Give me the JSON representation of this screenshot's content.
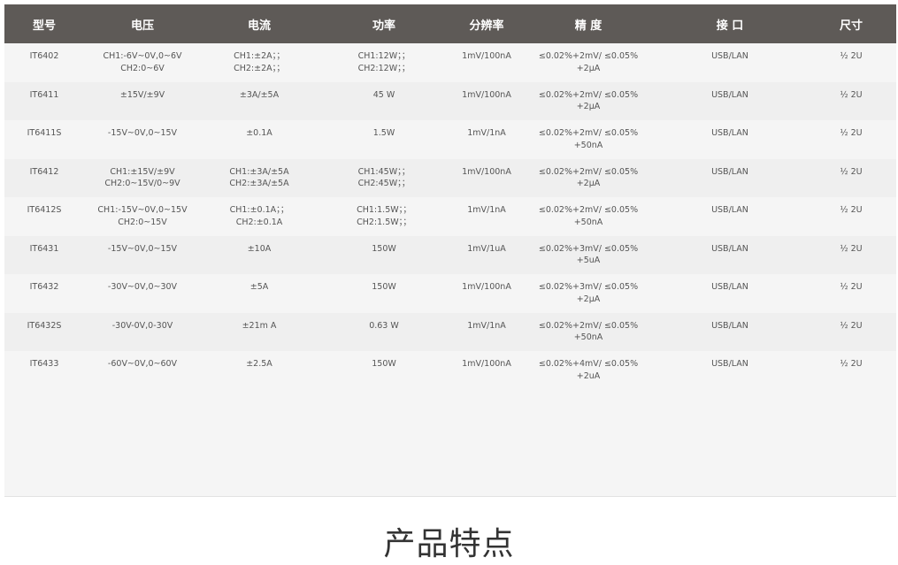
{
  "table": {
    "headers": [
      "型号",
      "电压",
      "电流",
      "功率",
      "分辨率",
      "精 度",
      "接 口",
      "尺寸"
    ],
    "rows": [
      {
        "model": "IT6402",
        "voltage": [
          "CH1:-6V~0V,0~6V",
          "CH2:0~6V"
        ],
        "current": [
          "CH1:±2A；；",
          "CH2:±2A；；"
        ],
        "power": [
          "CH1:12W；；",
          "CH2:12W；；"
        ],
        "resolution": [
          "1mV/100nA"
        ],
        "accuracy": [
          "≤0.02%+2mV/ ≤0.05%",
          "+2μA"
        ],
        "interface": "USB/LAN",
        "size": "½ 2U"
      },
      {
        "model": "IT6411",
        "voltage": [
          "±15V/±9V"
        ],
        "current": [
          "±3A/±5A"
        ],
        "power": [
          "45 W"
        ],
        "resolution": [
          "1mV/100nA"
        ],
        "accuracy": [
          "≤0.02%+2mV/ ≤0.05%",
          "+2μA"
        ],
        "interface": "USB/LAN",
        "size": "½ 2U"
      },
      {
        "model": "IT6411S",
        "voltage": [
          "-15V~0V,0~15V"
        ],
        "current": [
          "±0.1A"
        ],
        "power": [
          "1.5W"
        ],
        "resolution": [
          "1mV/1nA"
        ],
        "accuracy": [
          "≤0.02%+2mV/ ≤0.05%",
          "+50nA"
        ],
        "interface": "USB/LAN",
        "size": "½ 2U"
      },
      {
        "model": "IT6412",
        "voltage": [
          "CH1:±15V/±9V",
          "CH2:0~15V/0~9V"
        ],
        "current": [
          "CH1:±3A/±5A",
          "CH2:±3A/±5A"
        ],
        "power": [
          "CH1:45W；；",
          "CH2:45W；；"
        ],
        "resolution": [
          "1mV/100nA"
        ],
        "accuracy": [
          "≤0.02%+2mV/ ≤0.05%",
          "+2μA"
        ],
        "interface": "USB/LAN",
        "size": "½ 2U"
      },
      {
        "model": "IT6412S",
        "voltage": [
          "CH1:-15V~0V,0~15V",
          "CH2:0~15V"
        ],
        "current": [
          "CH1:±0.1A；；",
          "CH2:±0.1A"
        ],
        "power": [
          "CH1:1.5W；；",
          "CH2:1.5W；；"
        ],
        "resolution": [
          "1mV/1nA"
        ],
        "accuracy": [
          "≤0.02%+2mV/ ≤0.05%",
          "+50nA"
        ],
        "interface": "USB/LAN",
        "size": "½ 2U"
      },
      {
        "model": "IT6431",
        "voltage": [
          "-15V~0V,0~15V"
        ],
        "current": [
          "±10A"
        ],
        "power": [
          "150W"
        ],
        "resolution": [
          "1mV/1uA"
        ],
        "accuracy": [
          "≤0.02%+3mV/ ≤0.05%",
          "+5uA"
        ],
        "interface": "USB/LAN",
        "size": "½ 2U"
      },
      {
        "model": "IT6432",
        "voltage": [
          "-30V~0V,0~30V"
        ],
        "current": [
          "±5A"
        ],
        "power": [
          "150W"
        ],
        "resolution": [
          "1mV/100nA"
        ],
        "accuracy": [
          "≤0.02%+3mV/ ≤0.05%",
          "+2μA"
        ],
        "interface": "USB/LAN",
        "size": "½ 2U"
      },
      {
        "model": "IT6432S",
        "voltage": [
          "-30V-0V,0-30V"
        ],
        "current": [
          "±21m A"
        ],
        "power": [
          "0.63 W"
        ],
        "resolution": [
          "1mV/1nA"
        ],
        "accuracy": [
          "≤0.02%+2mV/ ≤0.05%",
          "+50nA"
        ],
        "interface": "USB/LAN",
        "size": "½ 2U"
      },
      {
        "model": "IT6433",
        "voltage": [
          "-60V~0V,0~60V"
        ],
        "current": [
          "±2.5A"
        ],
        "power": [
          "150W"
        ],
        "resolution": [
          "1mV/100nA"
        ],
        "accuracy": [
          "≤0.02%+4mV/ ≤0.05%",
          "+2uA"
        ],
        "interface": "USB/LAN",
        "size": "½ 2U"
      }
    ]
  },
  "section": {
    "title": "产品特点"
  }
}
